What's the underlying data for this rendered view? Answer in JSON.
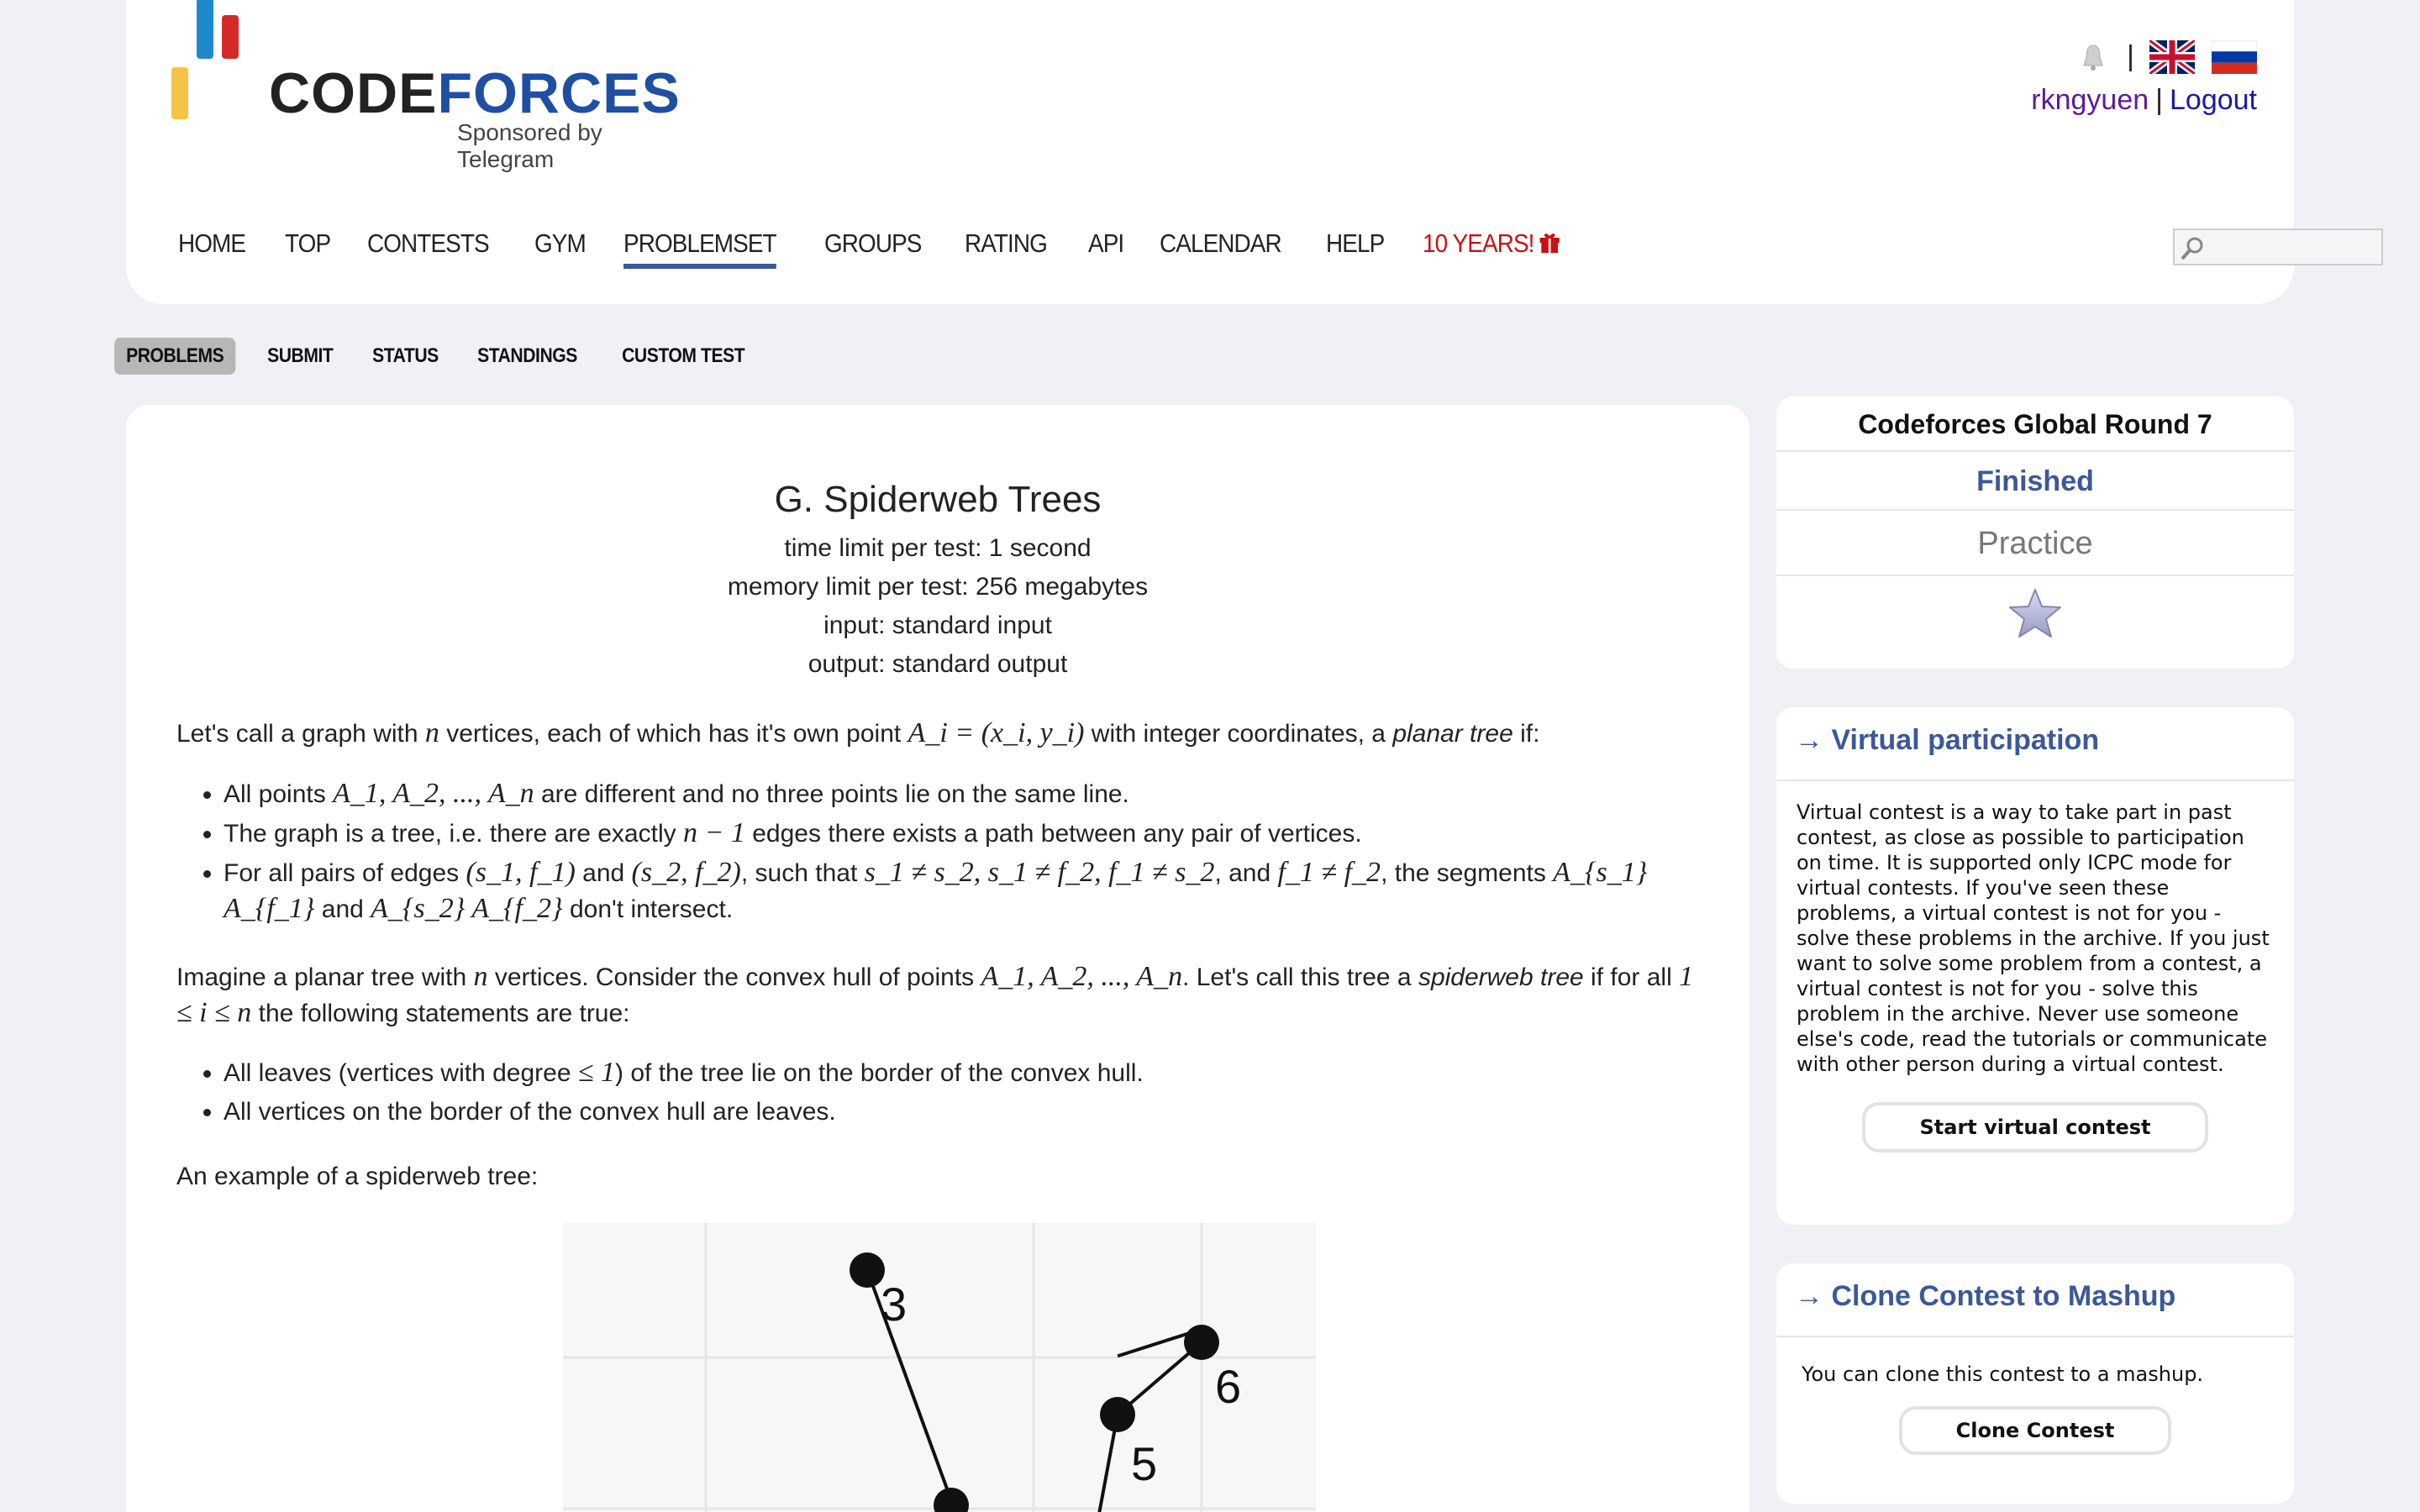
{
  "brand": {
    "name_part1": "Code",
    "name_part2": "forces",
    "tagline": "Sponsored by Telegram",
    "colors": {
      "yellow": "#f6c344",
      "blue": "#1f8acb",
      "red": "#d42a2a",
      "accent": "#3b5998"
    }
  },
  "user": {
    "username": "rkngyuen",
    "logout": "Logout",
    "separator": "|"
  },
  "icons": {
    "bell": "bell-icon",
    "uk_flag": "uk-flag-icon",
    "ru_flag": "ru-flag-icon",
    "search": "search-icon",
    "star": "star-icon",
    "gift": "gift-icon"
  },
  "menu": {
    "items": [
      "HOME",
      "TOP",
      "CONTESTS",
      "GYM",
      "PROBLEMSET",
      "GROUPS",
      "RATING",
      "API",
      "CALENDAR",
      "HELP"
    ],
    "special": "10 YEARS!",
    "active": "PROBLEMSET"
  },
  "submenu": {
    "items": [
      "PROBLEMS",
      "SUBMIT",
      "STATUS",
      "STANDINGS",
      "CUSTOM TEST"
    ],
    "active": "PROBLEMS"
  },
  "problem": {
    "title": "G. Spiderweb Trees",
    "time_limit": "time limit per test: 1 second",
    "memory_limit": "memory limit per test: 256 megabytes",
    "input": "input: standard input",
    "output": "output: standard output",
    "p1a": "Let's call a graph with ",
    "p1b": " vertices, each of which has it's own point ",
    "p1c": " with integer coordinates, a ",
    "p1d": "planar tree",
    "p1e": " if:",
    "b1a": "All points ",
    "b1b": " are different and no three points lie on the same line.",
    "b2a": "The graph is a tree, i.e. there are exactly ",
    "b2b": " edges there exists a path between any pair of vertices.",
    "b3a": "For all pairs of edges ",
    "b3b": " and ",
    "b3c": ", such that ",
    "b3d": ", and ",
    "b3e": ", the segments ",
    "b3f": " and ",
    "b3g": " don't intersect.",
    "p2a": "Imagine a planar tree with ",
    "p2b": " vertices. Consider the convex hull of points ",
    "p2c": ". Let's call this tree a ",
    "p2d": "spiderweb tree",
    "p2e": " if for all ",
    "p2f": " the following statements are true:",
    "c1a": "All leaves (vertices with degree ",
    "c1b": ") of the tree lie on the border of the convex hull.",
    "c2": "All vertices on the border of the convex hull are leaves.",
    "p3": "An example of a spiderweb tree:",
    "math": {
      "n": "n",
      "Ai": "A_i = (x_i, y_i)",
      "points": "A_1, A_2, ..., A_n",
      "nm1": "n − 1",
      "e1": "(s_1, f_1)",
      "e2": "(s_2, f_2)",
      "cond1": "s_1 ≠ s_2, s_1 ≠ f_2, f_1 ≠ s_2",
      "cond2": "f_1 ≠ f_2",
      "seg1": "A_{s_1} A_{f_1}",
      "seg2": "A_{s_2} A_{f_2}",
      "range": "1 ≤ i ≤ n",
      "deg": "≤ 1"
    },
    "figure_labels": [
      "3",
      "6",
      "5"
    ]
  },
  "sidebar": {
    "contest": {
      "name": "Codeforces Global Round 7",
      "status": "Finished",
      "mode": "Practice"
    },
    "virtual": {
      "title": "→ Virtual participation",
      "text": "Virtual contest is a way to take part in past contest, as close as possible to participation on time. It is supported only ICPC mode for virtual contests. If you've seen these problems, a virtual contest is not for you - solve these problems in the archive. If you just want to solve some problem from a contest, a virtual contest is not for you - solve this problem in the archive. Never use someone else's code, read the tutorials or communicate with other person during a virtual contest.",
      "button": "Start virtual contest"
    },
    "clone": {
      "title": "→ Clone Contest to Mashup",
      "text": "You can clone this contest to a mashup.",
      "button": "Clone Contest"
    }
  }
}
